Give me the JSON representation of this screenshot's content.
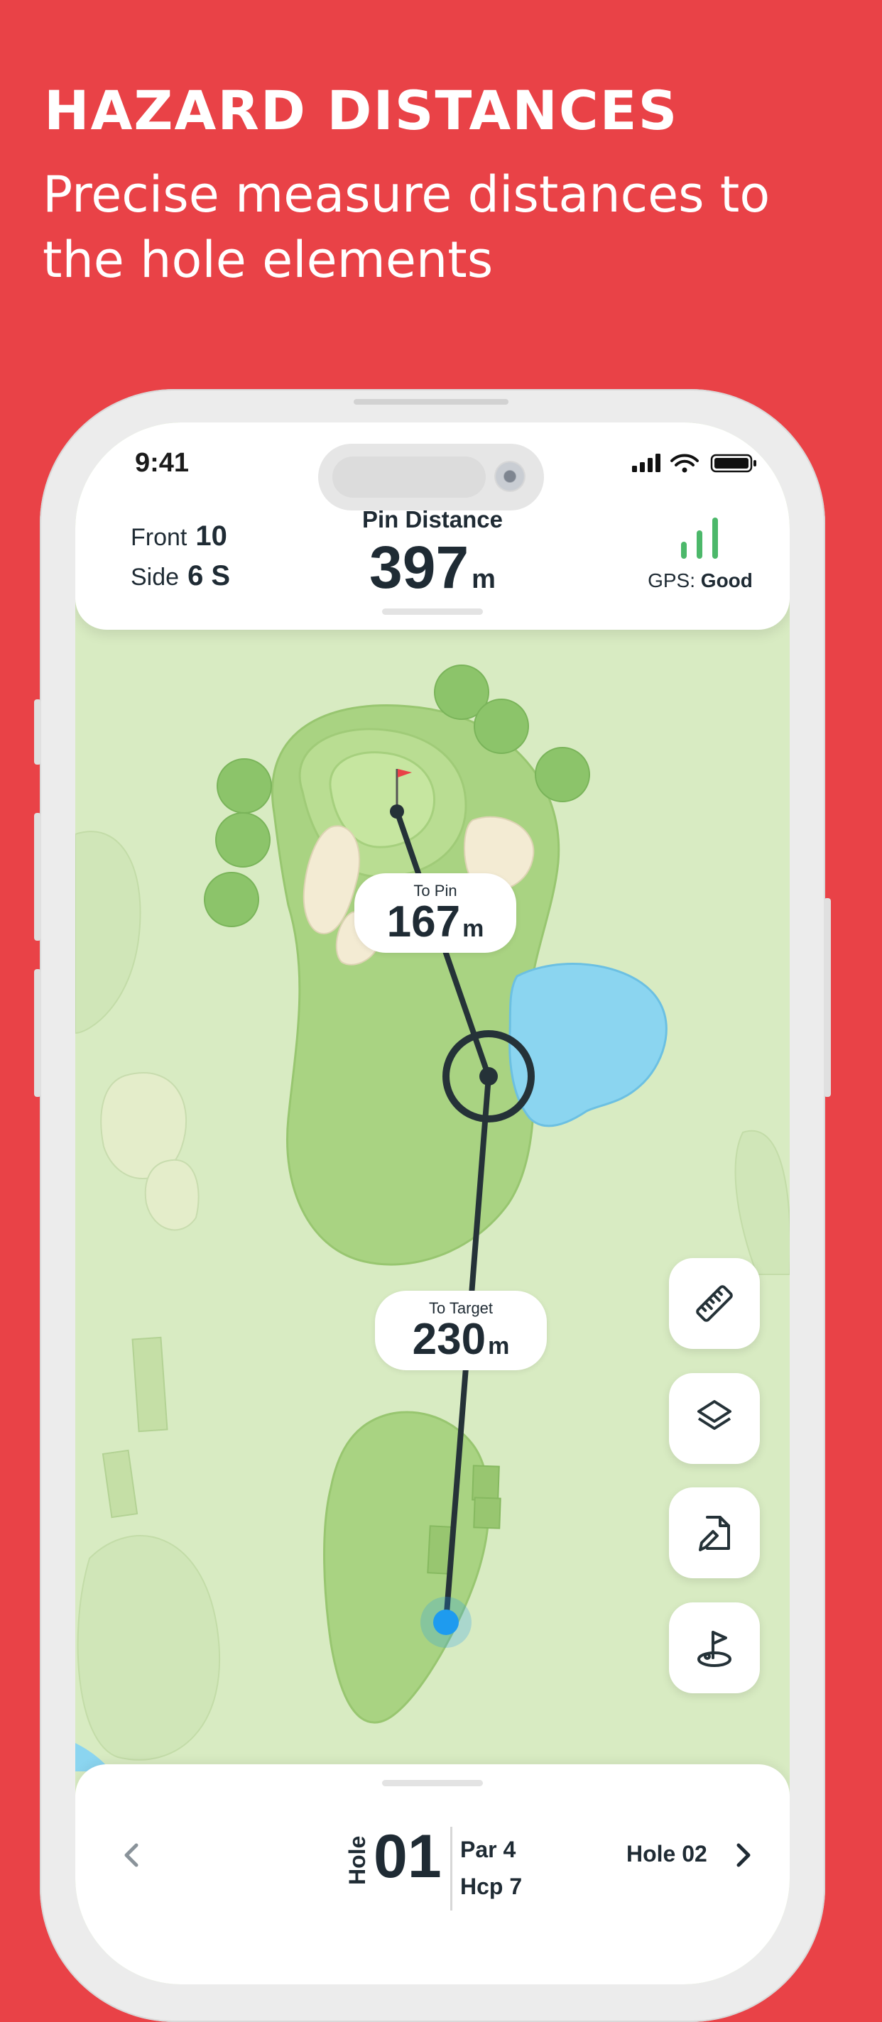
{
  "headline": "HAZARD DISTANCES",
  "subline": "Precise measure distances to the hole elements",
  "status_bar": {
    "time": "9:41"
  },
  "top_card": {
    "front_label": "Front",
    "front_value": "10",
    "side_label": "Side",
    "side_value": "6 S",
    "pin_title": "Pin Distance",
    "pin_value": "397",
    "pin_unit": "m",
    "gps_label": "GPS:",
    "gps_value": "Good"
  },
  "map": {
    "to_pin": {
      "label": "To Pin",
      "value": "167",
      "unit": "m"
    },
    "to_target": {
      "label": "To Target",
      "value": "230",
      "unit": "m"
    }
  },
  "tools": [
    {
      "icon": "ruler-icon"
    },
    {
      "icon": "layers-icon"
    },
    {
      "icon": "edit-document-icon"
    },
    {
      "icon": "golf-flag-icon"
    }
  ],
  "bottom_bar": {
    "hole_label": "Hole",
    "hole_number": "01",
    "par": "Par 4",
    "hcp": "Hcp 7",
    "next_label": "Hole 02"
  },
  "colors": {
    "background": "#E94247",
    "accent_green": "#4CB86A",
    "player_dot": "#1E9BEF"
  }
}
